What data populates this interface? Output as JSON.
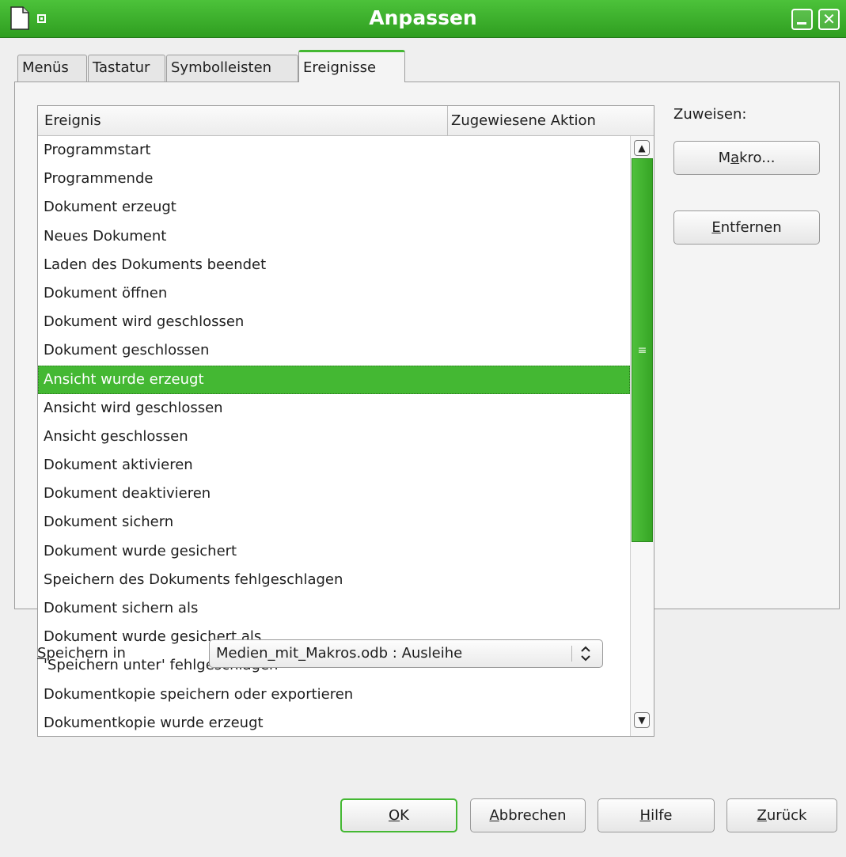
{
  "window": {
    "title": "Anpassen"
  },
  "tabs": [
    {
      "label": "Menüs"
    },
    {
      "label": "Tastatur"
    },
    {
      "label": "Symbolleisten"
    },
    {
      "label": "Ereignisse",
      "active": true
    }
  ],
  "event_list": {
    "columns": [
      "Ereignis",
      "Zugewiesene Aktion"
    ],
    "rows": [
      "Programmstart",
      "Programmende",
      "Dokument erzeugt",
      "Neues Dokument",
      "Laden des Dokuments beendet",
      "Dokument öffnen",
      "Dokument wird geschlossen",
      "Dokument geschlossen",
      "Ansicht wurde erzeugt",
      "Ansicht wird geschlossen",
      "Ansicht geschlossen",
      "Dokument aktivieren",
      "Dokument deaktivieren",
      "Dokument sichern",
      "Dokument wurde gesichert",
      "Speichern des Dokuments fehlgeschlagen",
      "Dokument sichern als",
      "Dokument wurde gesichert als",
      "'Speichern unter' fehlgeschlagen",
      "Dokumentkopie speichern oder exportieren",
      "Dokumentkopie wurde erzeugt"
    ],
    "selected_index": 8,
    "scroll_grip": "≡"
  },
  "assign": {
    "label": "Zuweisen:",
    "macro": {
      "pre": "M",
      "key": "a",
      "post": "kro..."
    },
    "remove": {
      "pre": "",
      "key": "E",
      "post": "ntfernen"
    }
  },
  "save_in": {
    "label": {
      "key": "S",
      "post": "peichern in"
    },
    "value": "Medien_mit_Makros.odb : Ausleihe"
  },
  "buttons": {
    "ok": {
      "key": "O",
      "post": "K"
    },
    "cancel": {
      "key": "A",
      "post": "bbrechen"
    },
    "help": {
      "key": "H",
      "post": "ilfe"
    },
    "back": {
      "key": "Z",
      "post": "urück"
    }
  },
  "colors": {
    "accent": "#44b833",
    "titlebar": "#3aae2b"
  },
  "icons": [
    "document-icon",
    "window-menu-icon",
    "minimize-icon",
    "close-icon",
    "scroll-up-icon",
    "scroll-down-icon",
    "updown-icon"
  ]
}
